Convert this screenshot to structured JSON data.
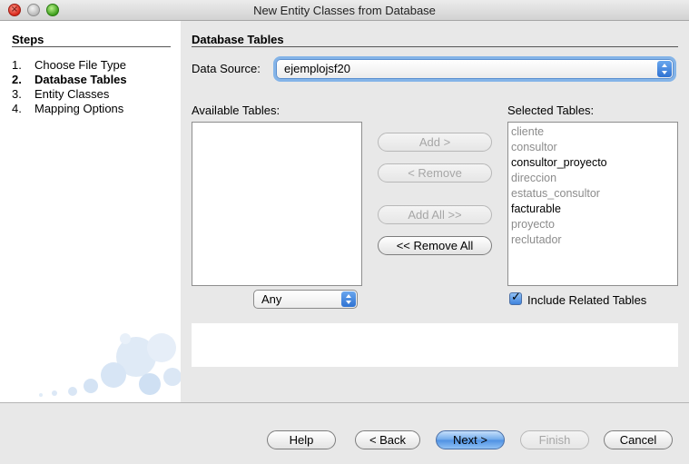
{
  "window": {
    "title": "New Entity Classes from Database"
  },
  "steps": {
    "heading": "Steps",
    "items": [
      {
        "num": "1.",
        "label": "Choose File Type",
        "active": false
      },
      {
        "num": "2.",
        "label": "Database Tables",
        "active": true
      },
      {
        "num": "3.",
        "label": "Entity Classes",
        "active": false
      },
      {
        "num": "4.",
        "label": "Mapping Options",
        "active": false
      }
    ]
  },
  "panel": {
    "title": "Database Tables",
    "data_source_label": "Data Source:",
    "data_source_value": "ejemplojsf20",
    "available_label": "Available Tables:",
    "available_items": [],
    "selected_label": "Selected Tables:",
    "selected_items": [
      {
        "name": "cliente",
        "dimmed": true
      },
      {
        "name": "consultor",
        "dimmed": true
      },
      {
        "name": "consultor_proyecto",
        "dimmed": false
      },
      {
        "name": "direccion",
        "dimmed": true
      },
      {
        "name": "estatus_consultor",
        "dimmed": true
      },
      {
        "name": "facturable",
        "dimmed": false
      },
      {
        "name": "proyecto",
        "dimmed": true
      },
      {
        "name": "reclutador",
        "dimmed": true
      }
    ],
    "filter_value": "Any",
    "include_related_label": "Include Related Tables",
    "include_related_checked": true,
    "buttons": {
      "add": "Add >",
      "remove": "< Remove",
      "add_all": "Add All >>",
      "remove_all": "<< Remove All"
    }
  },
  "footer": {
    "help": "Help",
    "back": "< Back",
    "next": "Next >",
    "finish": "Finish",
    "cancel": "Cancel"
  }
}
